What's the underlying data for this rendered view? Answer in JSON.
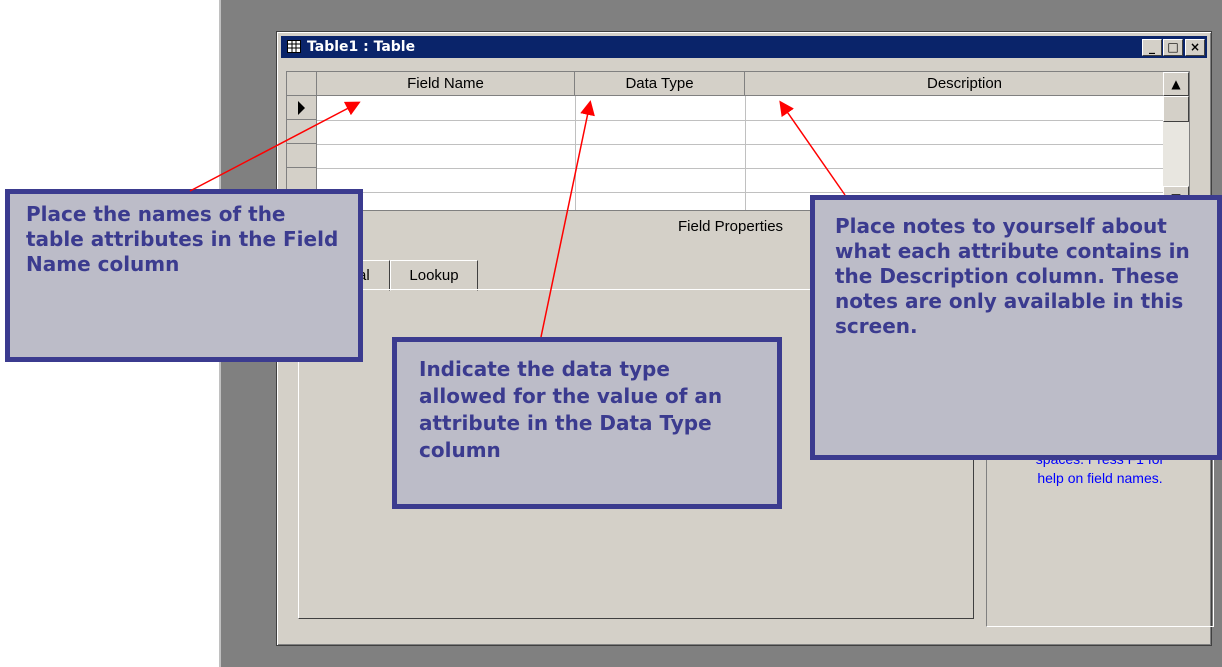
{
  "window": {
    "title": "Table1 : Table",
    "controls": {
      "minimize": "_",
      "maximize": "□",
      "close": "×"
    }
  },
  "grid": {
    "columns": [
      "Field Name",
      "Data Type",
      "Description"
    ]
  },
  "field_properties": {
    "label": "Field Properties",
    "tabs": [
      "General",
      "Lookup"
    ],
    "help_text_lines": [
      "spaces.  Press F1 for",
      "help on field names."
    ]
  },
  "callouts": {
    "field_name": "Place the names of the table attributes in the Field Name column",
    "data_type": "Indicate the data type allowed for the value of an attribute in the Data Type column",
    "description": "Place notes to yourself about what each attribute contains in the Description column. These notes are only available in this screen."
  },
  "colors": {
    "callout_border": "#3b3b8f",
    "callout_fill": "#bcbcc8",
    "arrow": "#ff0000",
    "titlebar": "#0a246a",
    "help_text": "#0000ff"
  }
}
